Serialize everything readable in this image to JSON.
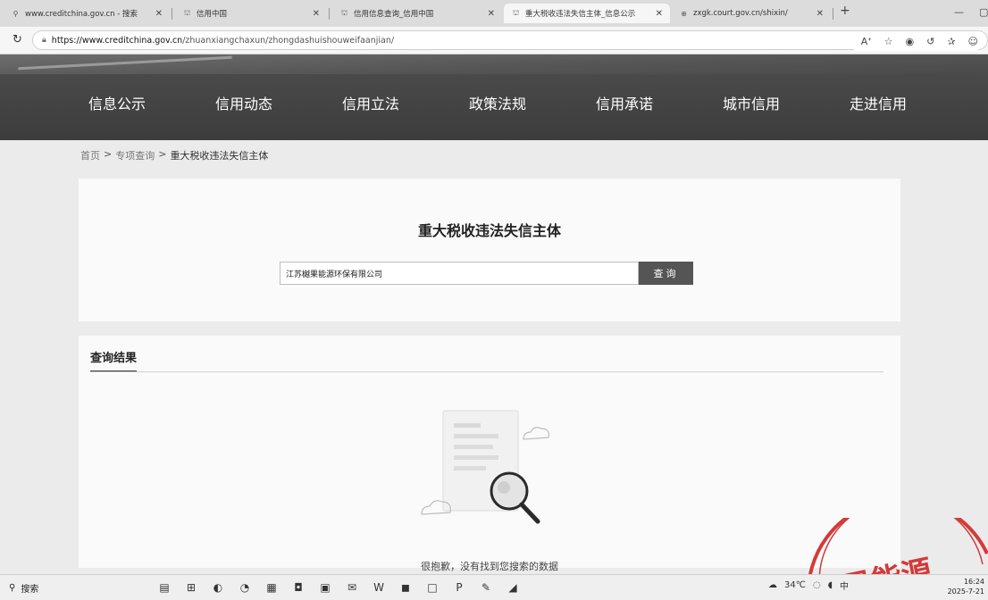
{
  "browser": {
    "tabs": [
      {
        "title": "www.creditchina.gov.cn - 搜索",
        "icon": "search-icon",
        "active": false
      },
      {
        "title": "信用中国",
        "icon": "site-icon",
        "active": false
      },
      {
        "title": "信用信息查询_信用中国",
        "icon": "site-icon",
        "active": false
      },
      {
        "title": "重大税收违法失信主体_信息公示",
        "icon": "site-icon",
        "active": true
      },
      {
        "title": "zxgk.court.gov.cn/shixin/",
        "icon": "globe-icon",
        "active": false
      }
    ],
    "new_tab": "+",
    "url_host": "https://www.creditchina.gov.cn",
    "url_path": "/zhuanxiangchaxun/zhongdashuishouweifaanjian/"
  },
  "nav": {
    "items": [
      "信息公示",
      "信用动态",
      "信用立法",
      "政策法规",
      "信用承诺",
      "城市信用",
      "走进信用"
    ]
  },
  "breadcrumb": {
    "home": "首页",
    "sep": ">",
    "section": "专项查询",
    "current": "重大税收违法失信主体"
  },
  "search": {
    "title": "重大税收违法失信主体",
    "input_value": "江苏樾果能源环保有限公司",
    "button": "查询"
  },
  "results": {
    "title": "查询结果",
    "empty_text": "很抱歉，没有找到您搜索的数据"
  },
  "stamp": {
    "text": "果能源"
  },
  "taskbar": {
    "search_label": "搜索",
    "weather": "34℃",
    "ime": "中",
    "time": "16:24",
    "date": "2025-7-21"
  }
}
